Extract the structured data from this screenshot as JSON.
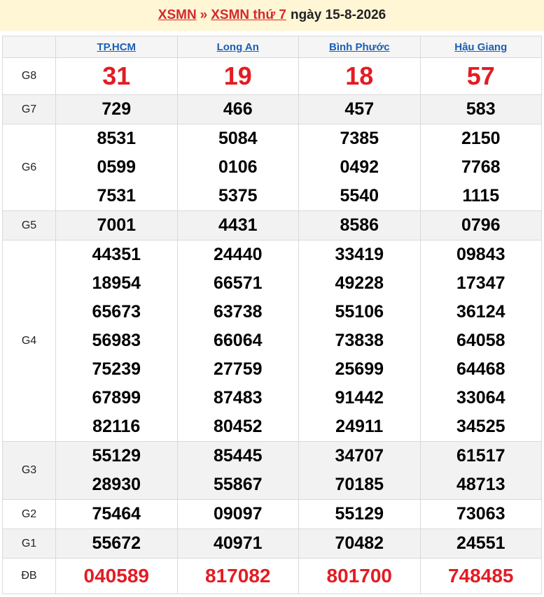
{
  "header": {
    "link1": "XSMN",
    "separator": "»",
    "link2": "XSMN thứ 7",
    "date_text": "ngày 15-8-2026"
  },
  "provinces": [
    "TP.HCM",
    "Long An",
    "Bình Phước",
    "Hậu Giang"
  ],
  "prizes": [
    {
      "label": "G8",
      "values": [
        [
          "31"
        ],
        [
          "19"
        ],
        [
          "18"
        ],
        [
          "57"
        ]
      ]
    },
    {
      "label": "G7",
      "values": [
        [
          "729"
        ],
        [
          "466"
        ],
        [
          "457"
        ],
        [
          "583"
        ]
      ]
    },
    {
      "label": "G6",
      "values": [
        [
          "8531",
          "0599",
          "7531"
        ],
        [
          "5084",
          "0106",
          "5375"
        ],
        [
          "7385",
          "0492",
          "5540"
        ],
        [
          "2150",
          "7768",
          "1115"
        ]
      ]
    },
    {
      "label": "G5",
      "values": [
        [
          "7001"
        ],
        [
          "4431"
        ],
        [
          "8586"
        ],
        [
          "0796"
        ]
      ]
    },
    {
      "label": "G4",
      "values": [
        [
          "44351",
          "18954",
          "65673",
          "56983",
          "75239",
          "67899",
          "82116"
        ],
        [
          "24440",
          "66571",
          "63738",
          "66064",
          "27759",
          "87483",
          "80452"
        ],
        [
          "33419",
          "49228",
          "55106",
          "73838",
          "25699",
          "91442",
          "24911"
        ],
        [
          "09843",
          "17347",
          "36124",
          "64058",
          "64468",
          "33064",
          "34525"
        ]
      ]
    },
    {
      "label": "G3",
      "values": [
        [
          "55129",
          "28930"
        ],
        [
          "85445",
          "55867"
        ],
        [
          "34707",
          "70185"
        ],
        [
          "61517",
          "48713"
        ]
      ]
    },
    {
      "label": "G2",
      "values": [
        [
          "75464"
        ],
        [
          "09097"
        ],
        [
          "55129"
        ],
        [
          "73063"
        ]
      ]
    },
    {
      "label": "G1",
      "values": [
        [
          "55672"
        ],
        [
          "40971"
        ],
        [
          "70482"
        ],
        [
          "24551"
        ]
      ]
    },
    {
      "label": "ĐB",
      "values": [
        [
          "040589"
        ],
        [
          "817082"
        ],
        [
          "801700"
        ],
        [
          "748485"
        ]
      ]
    }
  ],
  "colors": {
    "accent_red": "#e31c23",
    "link_blue": "#1a5fb4",
    "header_bg": "#fff6d6"
  }
}
